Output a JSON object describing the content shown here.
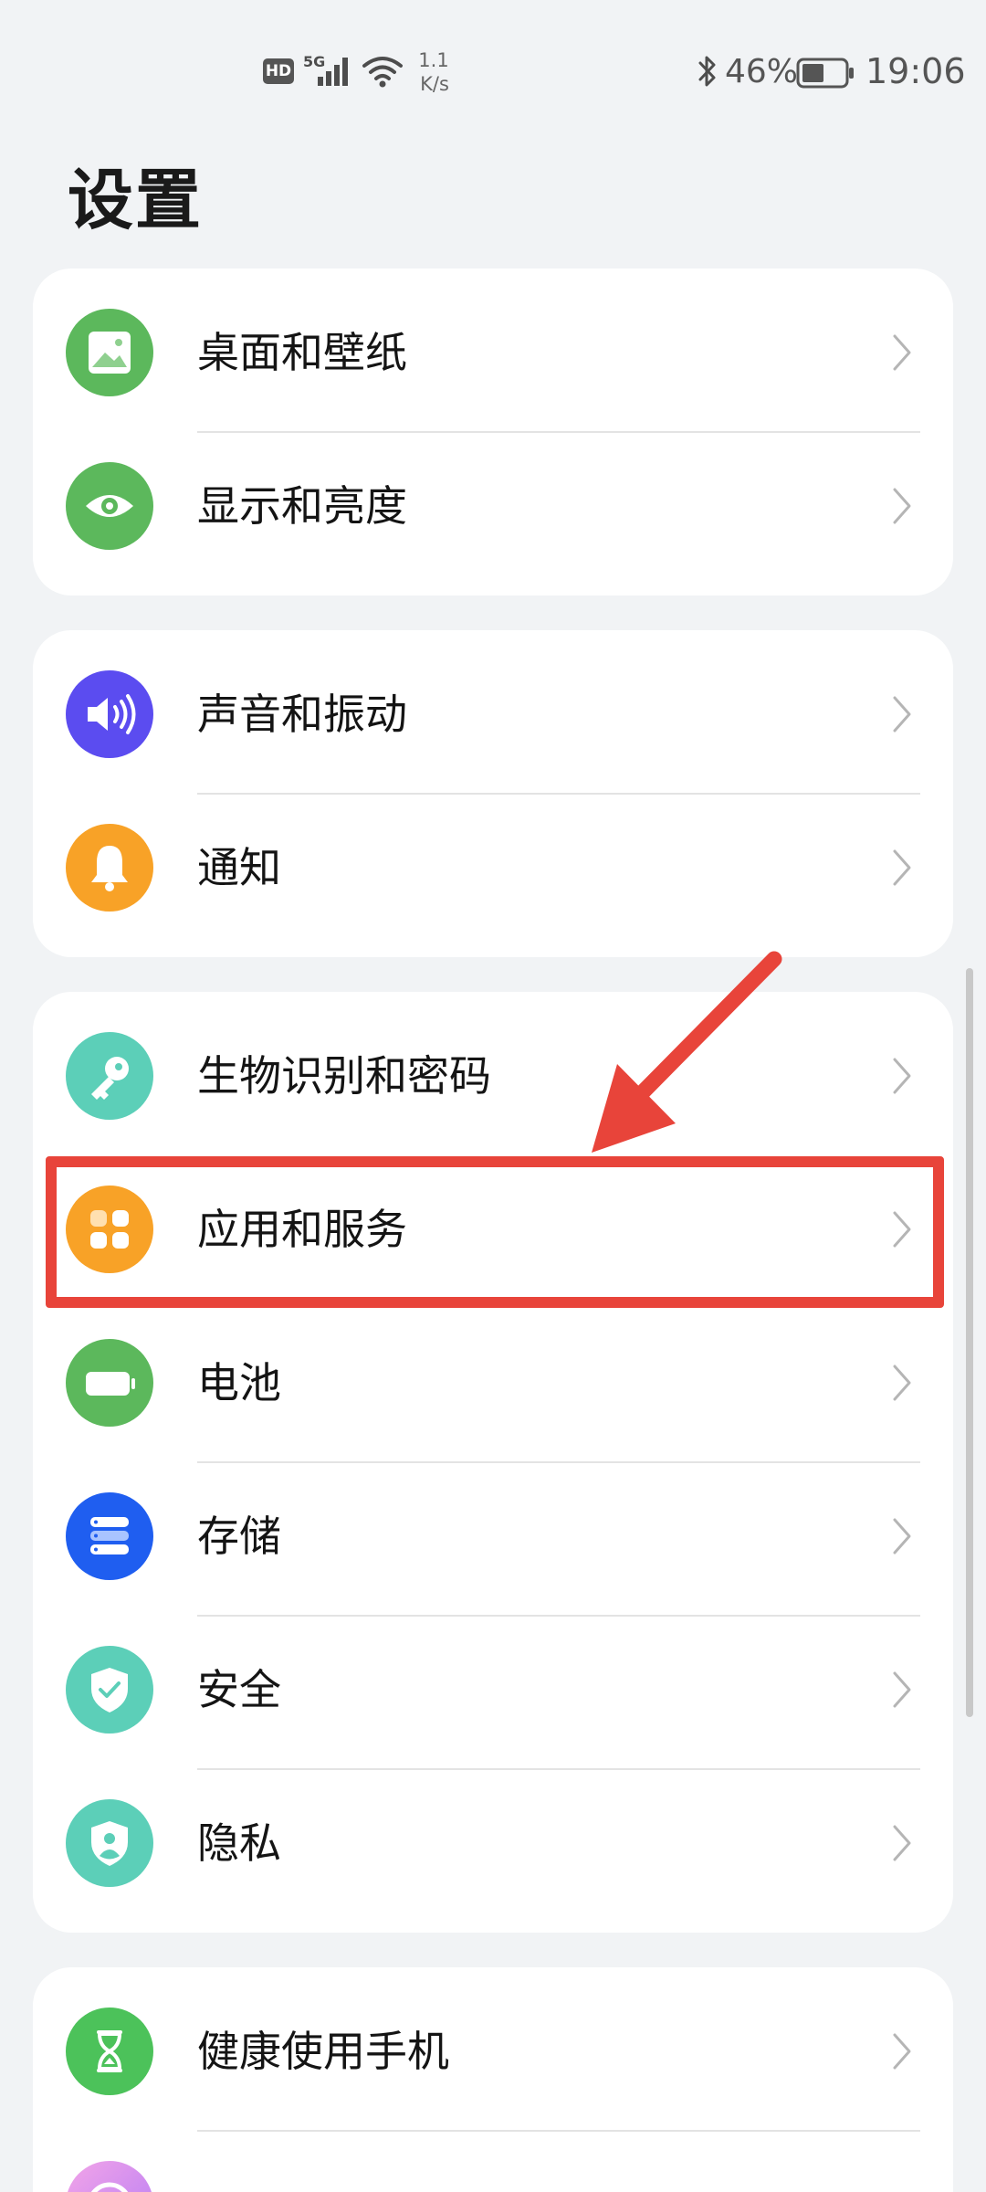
{
  "status_bar": {
    "hd": "HD",
    "network": "5G",
    "speed_value": "1.1",
    "speed_unit": "K/s",
    "battery": "46%",
    "time": "19:06"
  },
  "page": {
    "title": "设置"
  },
  "groups": [
    {
      "items": [
        {
          "label": "桌面和壁纸",
          "icon": "wallpaper-icon",
          "color": "#5cb85c"
        },
        {
          "label": "显示和亮度",
          "icon": "eye-icon",
          "color": "#5cb85c"
        }
      ]
    },
    {
      "items": [
        {
          "label": "声音和振动",
          "icon": "speaker-icon",
          "color": "#5b4cf0"
        },
        {
          "label": "通知",
          "icon": "bell-icon",
          "color": "#f8a227"
        }
      ]
    },
    {
      "items": [
        {
          "label": "生物识别和密码",
          "icon": "key-icon",
          "color": "#5ccfb8"
        },
        {
          "label": "应用和服务",
          "icon": "apps-grid-icon",
          "color": "#f8a227"
        },
        {
          "label": "电池",
          "icon": "battery-icon",
          "color": "#5cb85c"
        },
        {
          "label": "存储",
          "icon": "storage-icon",
          "color": "#1f5ef0"
        },
        {
          "label": "安全",
          "icon": "shield-check-icon",
          "color": "#5ccfb8"
        },
        {
          "label": "隐私",
          "icon": "privacy-shield-icon",
          "color": "#5ccfb8"
        }
      ]
    },
    {
      "items": [
        {
          "label": "健康使用手机",
          "icon": "hourglass-icon",
          "color": "#4cc25a"
        },
        {
          "label": "",
          "icon": "assistant-icon",
          "color": "#e86cd8"
        }
      ]
    }
  ],
  "highlight_color": "#e8443a"
}
